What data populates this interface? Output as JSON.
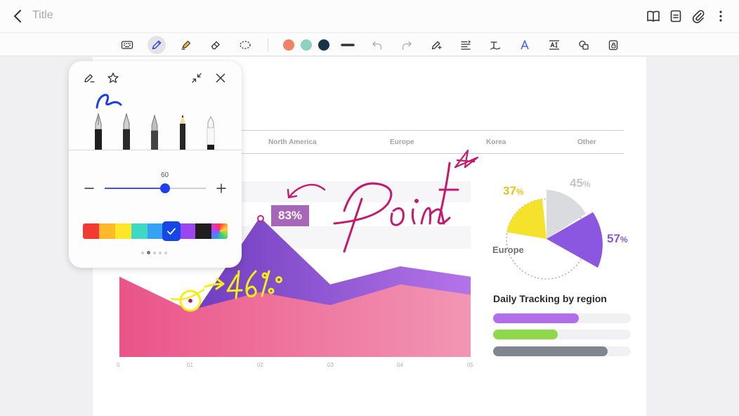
{
  "topbar": {
    "title": "Title",
    "icons": [
      "back-icon",
      "book-view-icon",
      "page-list-icon",
      "attach-icon",
      "more-icon"
    ]
  },
  "toolbar": {
    "tools": [
      "keyboard-icon",
      "pen-icon",
      "highlighter-icon",
      "eraser-icon",
      "lasso-icon"
    ],
    "active_tool": "pen-icon",
    "recent_colors": [
      "#f08268",
      "#8fd1c0",
      "#173446"
    ],
    "actions": [
      "stroke-width-icon",
      "undo-icon",
      "redo-icon",
      "pen-settings-icon",
      "text-align-icon",
      "handwriting-text-icon",
      "text-style-icon",
      "text-box-icon",
      "shape-icon",
      "lock-icon"
    ]
  },
  "pen_panel": {
    "size_value": "60",
    "size_fraction": 0.6,
    "colors": [
      "#f13a34",
      "#fdb929",
      "#fde72a",
      "#3fd8c5",
      "#37a2f3",
      "#1746e6",
      "#9c46f0",
      "#1f1f1f",
      "multicolor"
    ],
    "selected_color": "#1746e6",
    "pages": 5,
    "current_page": 1
  },
  "note": {
    "regions": [
      "North America",
      "Europe",
      "Korea",
      "Other"
    ],
    "x_ticks": [
      "0",
      "01",
      "02",
      "03",
      "04",
      "05"
    ],
    "badge": "83%",
    "handwriting": [
      "Point",
      "46%"
    ],
    "pie_labels": [
      {
        "value": "37",
        "unit": "%",
        "color": "#e8c81f"
      },
      {
        "value": "45",
        "unit": "%",
        "color": "#c9cbcf"
      },
      {
        "value": "57",
        "unit": "%",
        "color": "#8a58d7"
      }
    ],
    "pie_region": "Europe",
    "tracking_title": "Daily Tracking by region",
    "tracking_bars": [
      {
        "fraction": 0.62,
        "color": "#b26ee8"
      },
      {
        "fraction": 0.47,
        "color": "#8fd84c"
      },
      {
        "fraction": 0.83,
        "color": "#7f868d"
      }
    ]
  },
  "chart_data": {
    "type": "area",
    "categories": [
      "0",
      "01",
      "02",
      "03",
      "04",
      "05"
    ],
    "series": [
      {
        "values": [
          26,
          14,
          54,
          28,
          35,
          31
        ],
        "color": "#7a3cc4"
      },
      {
        "values": [
          31,
          18,
          25,
          20,
          28,
          24
        ],
        "color": "#ea5d8f"
      }
    ],
    "ylim": [
      0,
      70
    ]
  }
}
